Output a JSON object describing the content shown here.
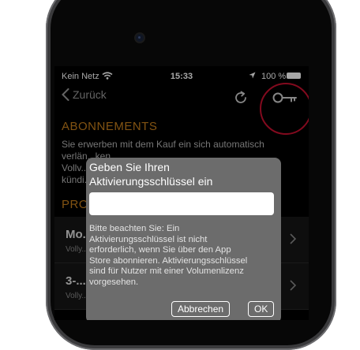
{
  "status_bar": {
    "carrier": "Kein Netz",
    "time": "15:33",
    "battery": "100 %"
  },
  "nav": {
    "back_label": "Zurück"
  },
  "section": {
    "title": "ABONNEMENTS",
    "text_lines": [
      "Sie erwerben mit dem Kauf ein sich automatisch",
      "verlän...ken",
      "Vollv...",
      "kündi..."
    ],
    "second_title": "PRO..."
  },
  "rows": [
    {
      "title": "Mo...",
      "subtitle": "Volly..."
    },
    {
      "title": "3-...",
      "subtitle": "Volly..."
    }
  ],
  "dialog": {
    "title_lines": [
      "Geben Sie Ihren",
      "Aktivierungsschlüssel ein"
    ],
    "input_value": "",
    "note_lines": [
      "Bitte beachten Sie: Ein",
      "Aktivierungsschlüssel ist nicht",
      "erforderlich, wenn Sie über den App",
      "Store abonnieren. Aktivierungsschlüssel",
      "sind für Nutzer mit einer Volumenlizenz",
      "vorgesehen."
    ],
    "cancel_label": "Abbrechen",
    "ok_label": "OK"
  },
  "icons": {
    "back": "chevron-left-icon",
    "refresh": "refresh-icon",
    "key": "key-icon",
    "row_chevron": "chevron-right-icon"
  },
  "colors": {
    "accent": "#c8801c",
    "annotation": "#c8102e"
  }
}
